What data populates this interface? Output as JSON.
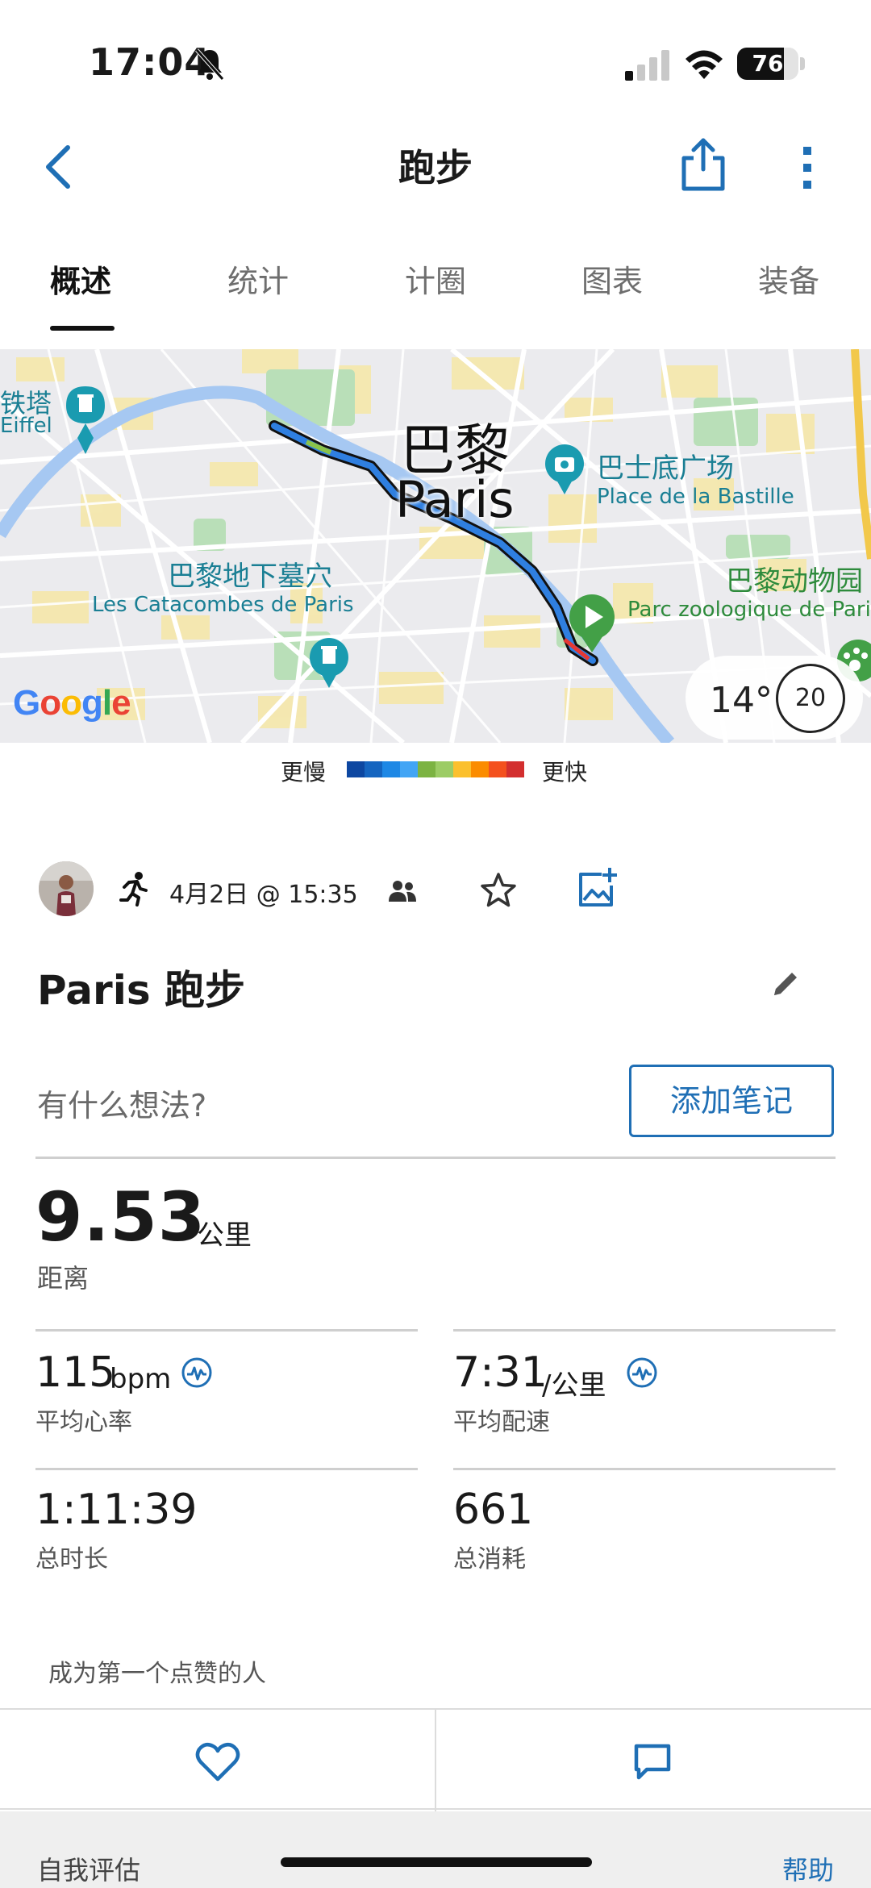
{
  "status_bar": {
    "time": "17:04",
    "battery_text": "76",
    "battery_level": 0.76
  },
  "header": {
    "title": "跑步"
  },
  "tabs": [
    {
      "label": "概述",
      "active": true
    },
    {
      "label": "统计",
      "active": false
    },
    {
      "label": "计圈",
      "active": false
    },
    {
      "label": "图表",
      "active": false
    },
    {
      "label": "装备",
      "active": false
    }
  ],
  "map": {
    "city_cn": "巴黎",
    "city_en": "Paris",
    "poi_eiffel_cn": "铁塔",
    "poi_eiffel_en": "Eiffel",
    "poi_bastille_cn": "巴士底广场",
    "poi_bastille_en": "Place de la Bastille",
    "poi_catacombs_cn": "巴黎地下墓穴",
    "poi_catacombs_en": "Les Catacombes de Paris",
    "poi_zoo_cn": "巴黎动物园",
    "poi_zoo_en": "Parc zoologique de Paris",
    "provider": "Google",
    "temperature": "14°",
    "wind": "20"
  },
  "legend": {
    "slow_label": "更慢",
    "fast_label": "更快",
    "colors": [
      "#0d47a1",
      "#1565c0",
      "#1e88e5",
      "#42a5f5",
      "#7cb342",
      "#9ccc65",
      "#fbc02d",
      "#fb8c00",
      "#f4511e",
      "#d32f2f"
    ]
  },
  "activity": {
    "date": "4月2日 @ 15:35",
    "title": "Paris 跑步",
    "notes_prompt": "有什么想法?",
    "add_note_label": "添加笔记"
  },
  "distance": {
    "value": "9.53",
    "unit": "公里",
    "label": "距离"
  },
  "stats": {
    "heart_rate": {
      "value": "115",
      "unit": "bpm",
      "label": "平均心率"
    },
    "pace": {
      "value": "7:31",
      "unit": "/公里",
      "label": "平均配速"
    },
    "duration": {
      "value": "1:11:39",
      "label": "总时长"
    },
    "calories": {
      "value": "661",
      "label": "总消耗"
    }
  },
  "social": {
    "like_prompt": "成为第一个点赞的人"
  },
  "footer": {
    "left": "自我评估",
    "right": "帮助"
  },
  "colors": {
    "accent_blue": "#1f6fb5",
    "map_marker_teal": "#1a9bb0",
    "start_marker_green": "#43a047"
  }
}
